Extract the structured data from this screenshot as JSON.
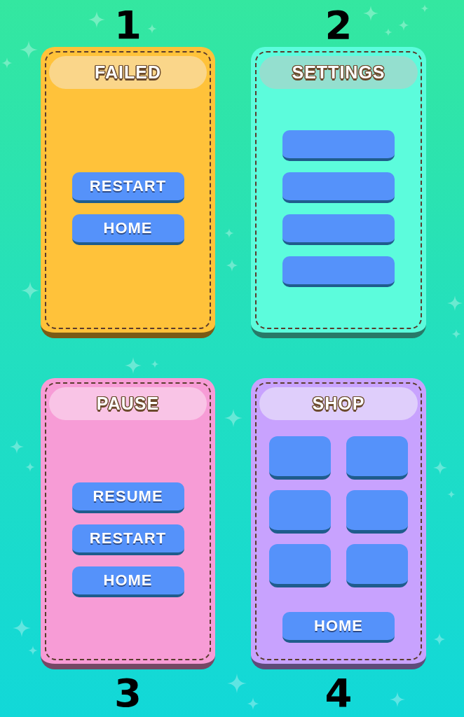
{
  "top_numbers": [
    "1",
    "2"
  ],
  "panels": [
    {
      "title": "FAILED",
      "color": "#ffc23a",
      "banner": {
        "color": "#fad68a"
      },
      "buttons": [
        {
          "kind": "text",
          "label": "RESTART"
        },
        {
          "kind": "text",
          "label": "HOME"
        }
      ]
    },
    {
      "title": "SETTINGS",
      "color": "#5cfcdc",
      "banner": {
        "color": "#94dfcf"
      },
      "buttons": [
        {
          "kind": "blank"
        },
        {
          "kind": "blank"
        },
        {
          "kind": "blank"
        },
        {
          "kind": "blank"
        }
      ]
    },
    {
      "title": "PAUSE",
      "color": "#f79cd6",
      "banner": {
        "color": "#f9c4e6"
      },
      "buttons": [
        {
          "kind": "text",
          "label": "RESUME"
        },
        {
          "kind": "text",
          "label": "RESTART"
        },
        {
          "kind": "text",
          "label": "HOME"
        }
      ]
    },
    {
      "title": "SHOP",
      "color": "#c8a2fe",
      "banner": {
        "color": "#dfcefb"
      },
      "tiles": [
        {
          "kind": "blank"
        },
        {
          "kind": "blank"
        },
        {
          "kind": "blank"
        },
        {
          "kind": "blank"
        },
        {
          "kind": "blank"
        },
        {
          "kind": "blank"
        }
      ],
      "buttons": [
        {
          "kind": "text",
          "label": "HOME"
        }
      ]
    }
  ],
  "bottom_numbers": [
    "3",
    "4"
  ]
}
